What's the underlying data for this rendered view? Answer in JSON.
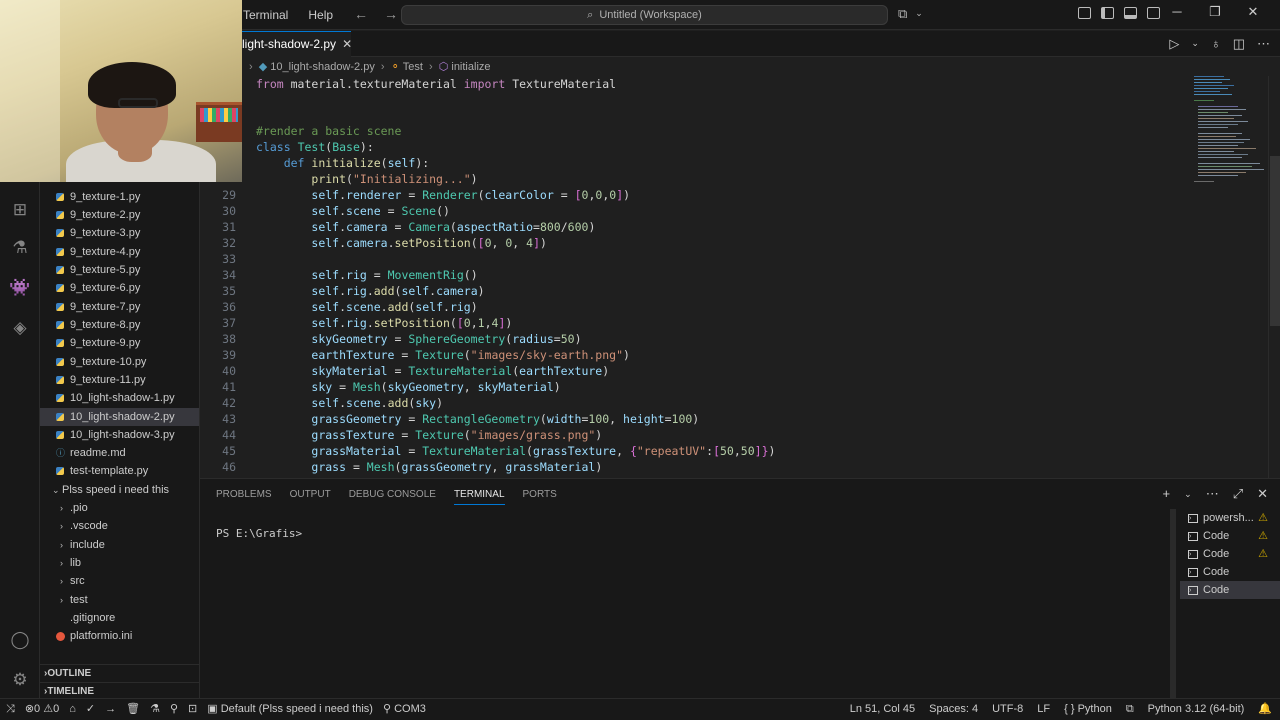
{
  "menu": {
    "terminal": "Terminal",
    "help": "Help"
  },
  "nav": {
    "back": "←",
    "forward": "→"
  },
  "command_center": {
    "text": "Untitled (Workspace)",
    "icon": "search-icon"
  },
  "window_controls": {
    "minimize": "─",
    "maximize": "❐",
    "close": "✕"
  },
  "sidebar": {
    "files": [
      {
        "name": "9_texture-1.py",
        "icon": "python-file-icon"
      },
      {
        "name": "9_texture-2.py",
        "icon": "python-file-icon"
      },
      {
        "name": "9_texture-3.py",
        "icon": "python-file-icon"
      },
      {
        "name": "9_texture-4.py",
        "icon": "python-file-icon"
      },
      {
        "name": "9_texture-5.py",
        "icon": "python-file-icon"
      },
      {
        "name": "9_texture-6.py",
        "icon": "python-file-icon"
      },
      {
        "name": "9_texture-7.py",
        "icon": "python-file-icon"
      },
      {
        "name": "9_texture-8.py",
        "icon": "python-file-icon"
      },
      {
        "name": "9_texture-9.py",
        "icon": "python-file-icon"
      },
      {
        "name": "9_texture-10.py",
        "icon": "python-file-icon"
      },
      {
        "name": "9_texture-11.py",
        "icon": "python-file-icon"
      },
      {
        "name": "10_light-shadow-1.py",
        "icon": "python-file-icon"
      },
      {
        "name": "10_light-shadow-2.py",
        "icon": "python-file-icon"
      },
      {
        "name": "10_light-shadow-3.py",
        "icon": "python-file-icon"
      },
      {
        "name": "readme.md",
        "icon": "markdown-file-icon"
      },
      {
        "name": "test-template.py",
        "icon": "python-file-icon"
      }
    ],
    "folder_name": "Plss speed i need this",
    "folder_items": [
      ".pio",
      ".vscode",
      "include",
      "lib",
      "src",
      "test"
    ],
    "gitignore": ".gitignore",
    "platformio": "platformio.ini",
    "outline": "OUTLINE",
    "timeline": "TIMELINE"
  },
  "tab": {
    "label": "light-shadow-2.py",
    "close": "✕"
  },
  "breadcrumb": {
    "file": "10_light-shadow-2.py",
    "class": "Test",
    "method": "initialize"
  },
  "code": {
    "l_import": [
      "from",
      " material.textureMaterial ",
      "import",
      " TextureMaterial"
    ],
    "l_comment": "#render a basic scene",
    "numbers": [
      "29",
      "30",
      "31",
      "32",
      "33",
      "34",
      "35",
      "36",
      "37",
      "38",
      "39",
      "40",
      "41",
      "42",
      "43",
      "44",
      "45",
      "46"
    ]
  },
  "panel": {
    "tabs": [
      "PROBLEMS",
      "OUTPUT",
      "DEBUG CONSOLE",
      "TERMINAL",
      "PORTS"
    ],
    "prompt": "PS E:\\Grafis>",
    "terminals": [
      {
        "name": "powersh...",
        "warn": "⚠"
      },
      {
        "name": "Code",
        "warn": "⚠"
      },
      {
        "name": "Code",
        "warn": "⚠"
      },
      {
        "name": "Code",
        "warn": ""
      },
      {
        "name": "Code",
        "warn": ""
      }
    ]
  },
  "statusbar": {
    "errors": "0",
    "warnings": "0",
    "project": "Default (Plss speed i need this)",
    "port": "COM3",
    "position": "Ln 51, Col 45",
    "spaces": "Spaces: 4",
    "encoding": "UTF-8",
    "eol": "LF",
    "language": "Python",
    "interpreter": "Python 3.12 (64-bit)"
  }
}
